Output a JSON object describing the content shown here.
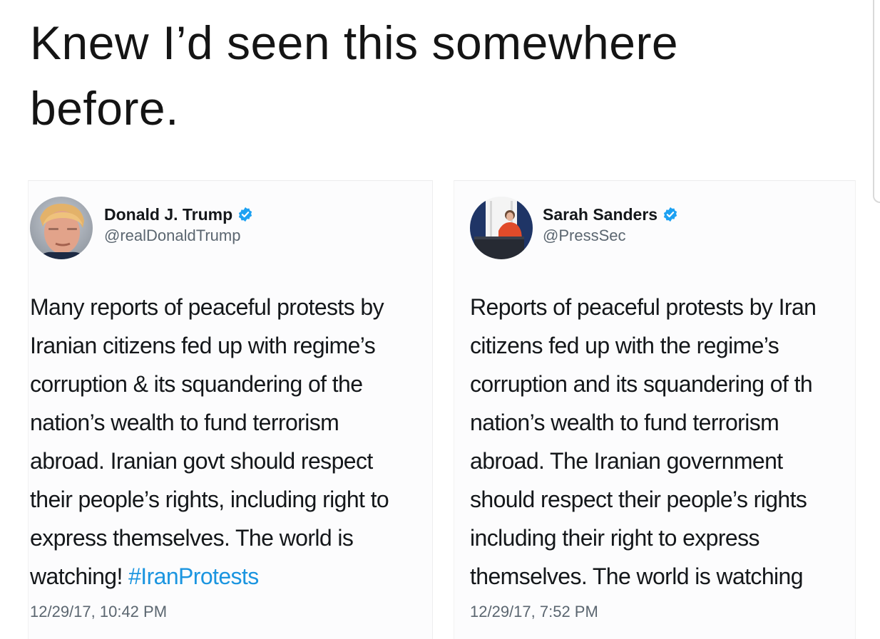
{
  "headline": {
    "line1": "Knew I’d seen this somewhere",
    "line2": "before."
  },
  "tweets": [
    {
      "name": "Donald J. Trump",
      "handle": "@realDonaldTrump",
      "verified_icon": "verified-badge-icon",
      "lines": [
        "Many reports of peaceful protests by",
        "Iranian citizens fed up with regime’s",
        "corruption & its squandering of the",
        "nation’s wealth to fund terrorism",
        "abroad. Iranian govt should respect",
        "their people’s rights, including right to",
        "express themselves. The world is",
        "watching!"
      ],
      "hashtag": "#IranProtests",
      "timestamp": "12/29/17, 10:42 PM"
    },
    {
      "name": "Sarah Sanders",
      "handle": "@PressSec",
      "verified_icon": "verified-badge-icon",
      "lines": [
        "Reports of peaceful protests by Iran",
        "citizens fed up with the regime’s",
        "corruption and its squandering of th",
        "nation’s wealth to fund terrorism",
        "abroad. The Iranian government",
        "should respect their people’s rights",
        "including their right to express",
        "themselves. The world is watching"
      ],
      "timestamp": "12/29/17, 7:52 PM"
    }
  ],
  "colors": {
    "hashtag": "#1b95e0",
    "verified": "#1da1f2",
    "handle": "#5b6670"
  }
}
